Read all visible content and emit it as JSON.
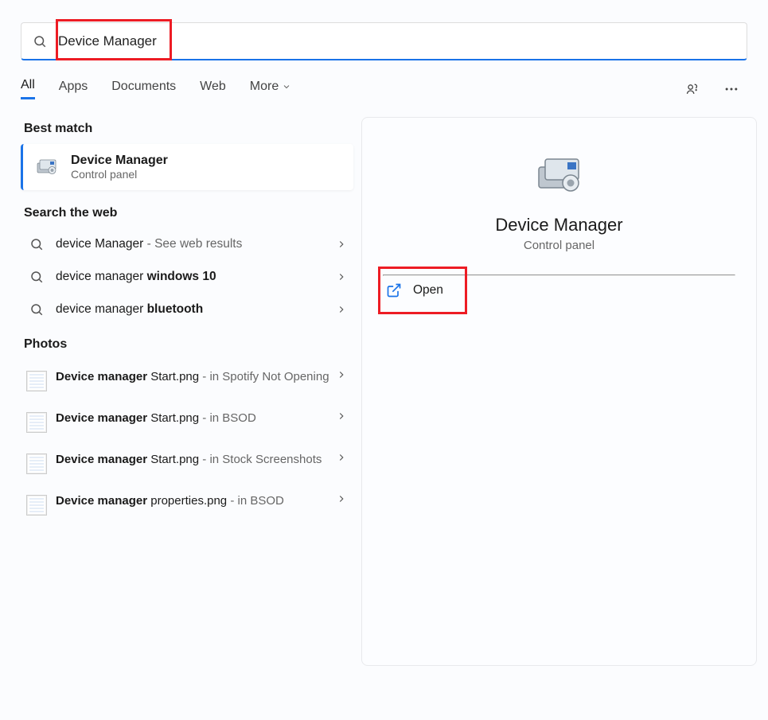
{
  "search": {
    "value": "Device Manager"
  },
  "tabs": {
    "t0": "All",
    "t1": "Apps",
    "t2": "Documents",
    "t3": "Web",
    "t4": "More"
  },
  "sections": {
    "best": "Best match",
    "web": "Search the web",
    "photos": "Photos"
  },
  "best_match": {
    "title": "Device Manager",
    "subtitle": "Control panel"
  },
  "web_results": [
    {
      "prefix": "device Manager",
      "bold": "",
      "suffix": " - See web results"
    },
    {
      "prefix": "device manager ",
      "bold": "windows 10",
      "suffix": ""
    },
    {
      "prefix": "device manager ",
      "bold": "bluetooth",
      "suffix": ""
    }
  ],
  "photos": [
    {
      "bold": "Device manager",
      "rest": " Start.png",
      "sub": " - in Spotify Not Opening"
    },
    {
      "bold": "Device manager",
      "rest": " Start.png",
      "sub": " - in BSOD"
    },
    {
      "bold": "Device manager",
      "rest": " Start.png",
      "sub": " - in Stock Screenshots"
    },
    {
      "bold": "Device manager",
      "rest": " properties.png",
      "sub": " - in BSOD"
    }
  ],
  "preview": {
    "title": "Device Manager",
    "subtitle": "Control panel",
    "open": "Open"
  }
}
